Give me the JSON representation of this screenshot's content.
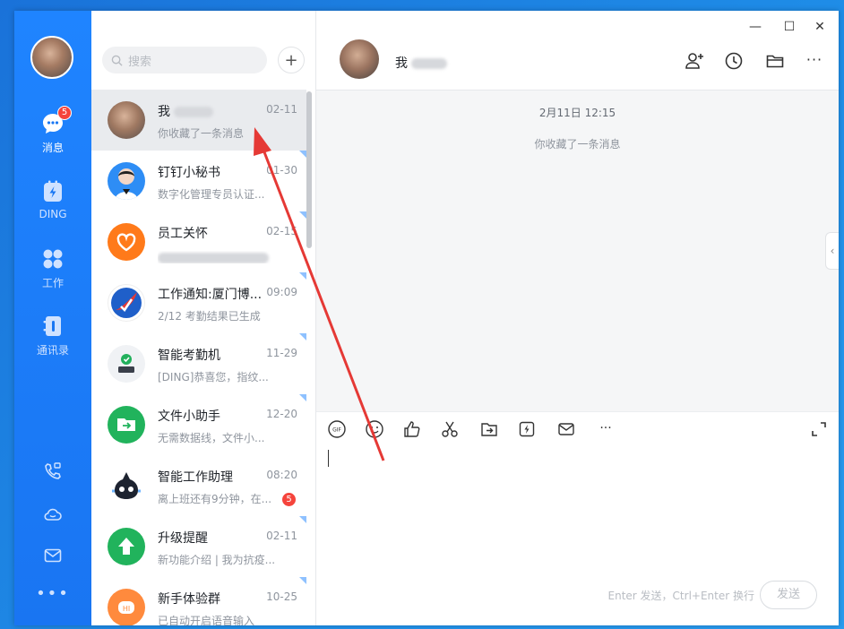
{
  "rail": {
    "avatar_alt": "",
    "items": [
      {
        "label": "消息",
        "icon": "chat-bubble-icon",
        "badge": "5",
        "active": true
      },
      {
        "label": "DING",
        "icon": "ding-icon",
        "active": false
      },
      {
        "label": "工作",
        "icon": "grid-apps-icon",
        "active": false
      },
      {
        "label": "通讯录",
        "icon": "contacts-book-icon",
        "active": false
      }
    ],
    "bottom_icons": [
      "phone-video-icon",
      "cloud-icon",
      "mail-icon",
      "more-dots-icon"
    ]
  },
  "search": {
    "placeholder": "搜索"
  },
  "conversations": [
    {
      "name": "我",
      "time": "02-11",
      "preview": "你收藏了一条消息",
      "avatar": "user-photo",
      "selected": true
    },
    {
      "name": "钉钉小秘书",
      "time": "01-30",
      "preview": "数字化管理专员认证...",
      "avatar": "assistant-photo"
    },
    {
      "name": "员工关怀",
      "time": "02-15",
      "preview": "",
      "avatar": "heart-orange"
    },
    {
      "name": "工作通知:厦门博...",
      "time": "09:09",
      "preview": "2/12 考勤结果已生成",
      "avatar": "work-notice-logo"
    },
    {
      "name": "智能考勤机",
      "time": "11-29",
      "preview": "[DING]恭喜您，指纹...",
      "avatar": "attendance-machine"
    },
    {
      "name": "文件小助手",
      "time": "12-20",
      "preview": "无需数据线，文件小...",
      "avatar": "file-helper-green"
    },
    {
      "name": "智能工作助理",
      "time": "08:20",
      "preview": "离上班还有9分钟，在...",
      "avatar": "robot-dark",
      "badge": "5"
    },
    {
      "name": "升级提醒",
      "time": "02-11",
      "preview": "新功能介绍 | 我为抗疫...",
      "avatar": "upgrade-green"
    },
    {
      "name": "新手体验群",
      "time": "10-25",
      "preview": "已自动开启语音输入",
      "avatar": "hi-orange"
    }
  ],
  "chat": {
    "title": "我",
    "header_icons": [
      "add-person-icon",
      "clock-icon",
      "folder-icon",
      "more-dots-icon"
    ],
    "window_controls": [
      "minimize-icon",
      "maximize-icon",
      "close-icon"
    ],
    "messages": {
      "time": "2月11日 12:15",
      "system": "你收藏了一条消息"
    },
    "toolbar_icons": [
      "gif-icon",
      "emoji-icon",
      "thumbs-up-icon",
      "scissors-icon",
      "folder-send-icon",
      "ding-small-icon",
      "mail-icon",
      "more-dots-icon"
    ],
    "hint": "Enter 发送，Ctrl+Enter 换行",
    "send_label": "发送"
  },
  "colors": {
    "rail": "#1976f2",
    "accent": "#1677ff",
    "badge": "#f5443c",
    "arrow": "#e53935"
  }
}
